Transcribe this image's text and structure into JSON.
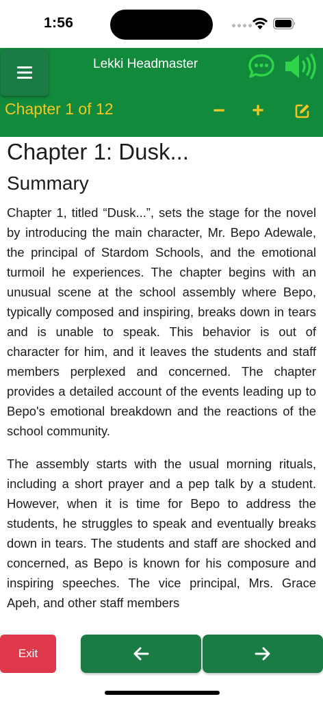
{
  "status_bar": {
    "time": "1:56"
  },
  "header": {
    "title": "Lekki Headmaster",
    "chapter_indicator": "Chapter 1 of 12",
    "minus_label": "−",
    "plus_label": "+",
    "icons": {
      "menu": "hamburger-menu-icon",
      "chat": "chat-bubble-icon",
      "speaker": "speaker-volume-icon",
      "edit": "edit-pencil-icon"
    },
    "colors": {
      "bar": "#128a3c",
      "accent": "#f3c623",
      "icon_green": "#2fd44a"
    }
  },
  "content": {
    "chapter_title": "Chapter 1: Dusk...",
    "summary_heading": "Summary",
    "paragraphs": [
      "Chapter 1, titled “Dusk...”, sets the stage for the novel by introducing the main character, Mr. Bepo Adewale, the principal of Stardom Schools, and the emotional turmoil he experiences. The chapter begins with an unusual scene at the school assembly where Bepo, typically composed and inspiring, breaks down in tears and is unable to speak. This behavior is out of character for him, and it leaves the students and staff members perplexed and concerned. The chapter provides a detailed account of the events leading up to Bepo's emotional breakdown and the reactions of the school community.",
      "The assembly starts with the usual morning rituals, including a short prayer and a pep talk by a student. However, when it is time for Bepo to address the students, he struggles to speak and eventually breaks down in tears. The students and staff are shocked and concerned, as Bepo is known for his composure and inspiring speeches. The vice principal, Mrs. Grace Apeh, and other staff members"
    ]
  },
  "footer": {
    "exit_label": "Exit",
    "prev_icon": "arrow-left-icon",
    "next_icon": "arrow-right-icon",
    "colors": {
      "exit": "#e0384b",
      "nav": "#1a7b45"
    }
  }
}
